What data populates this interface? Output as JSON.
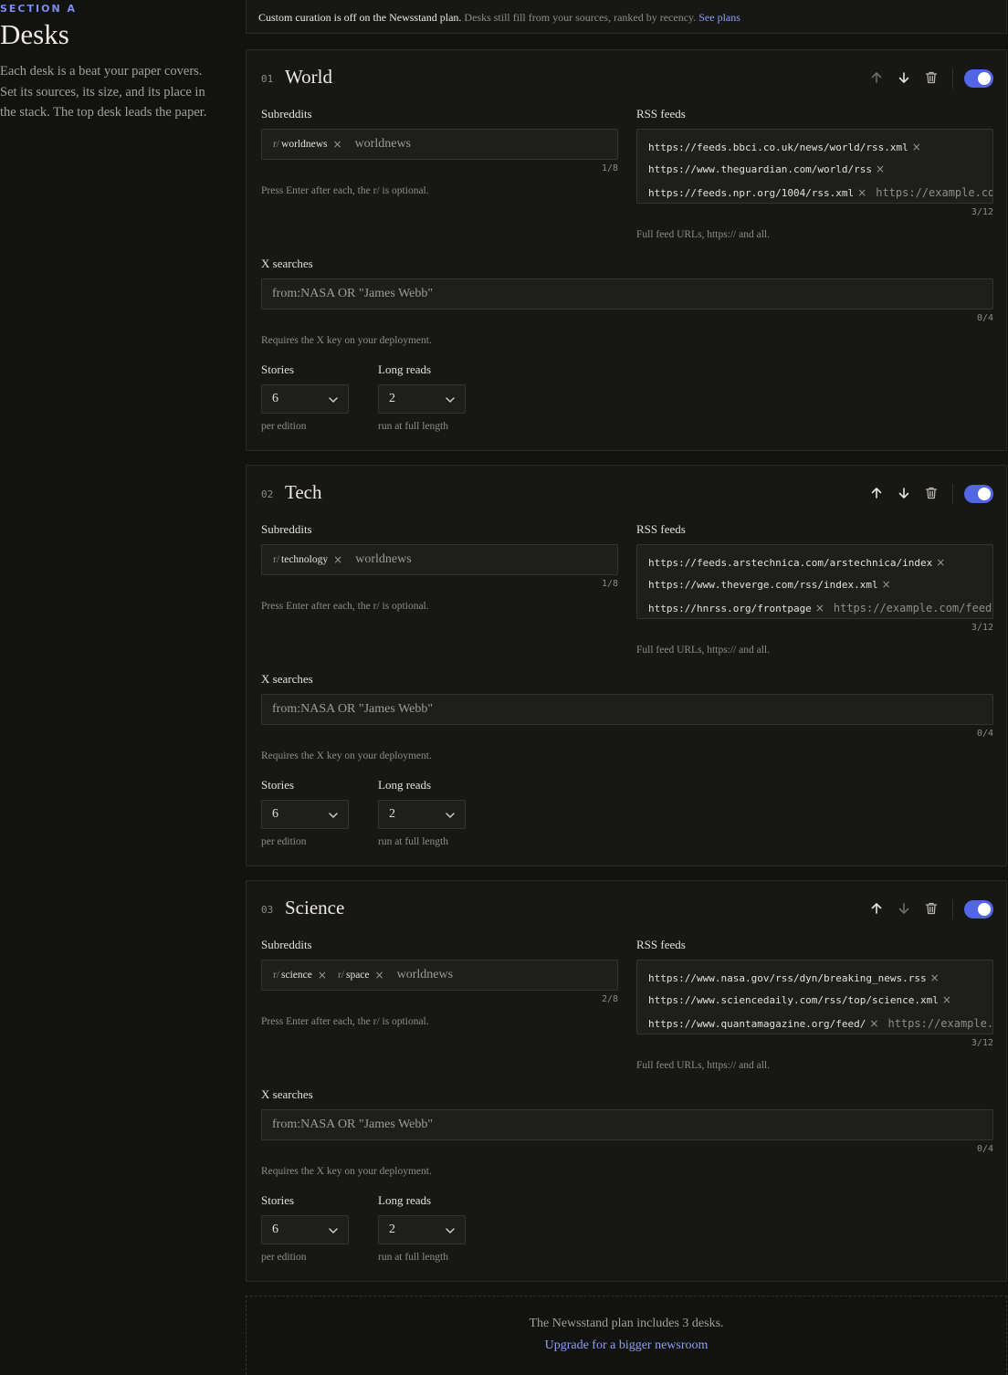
{
  "section": {
    "label": "SECTION A",
    "title": "Desks",
    "description": "Each desk is a beat your paper covers. Set its sources, its size, and its place in the stack. The top desk leads the paper."
  },
  "notice": {
    "strong": "Custom curation is off on the Newsstand plan.",
    "text": " Desks still fill from your sources, ranked by recency. ",
    "link": "See plans"
  },
  "labels": {
    "subreddits": "Subreddits",
    "rss_feeds": "RSS feeds",
    "x_searches": "X searches",
    "stories": "Stories",
    "long_reads": "Long reads",
    "subreddit_hint": "Press Enter after each, the r/ is optional.",
    "rss_hint": "Full feed URLs, https:// and all.",
    "x_hint": "Requires the X key on your deployment.",
    "stories_hint": "per edition",
    "long_reads_hint": "run at full length",
    "subreddit_prefix": "r/",
    "subreddit_placeholder": "worldnews",
    "feed_placeholder": "https://example.com/feed",
    "x_placeholder": "from:NASA OR \"James Webb\""
  },
  "desks": [
    {
      "num": "01",
      "name": "World",
      "subreddits": [
        "worldnews"
      ],
      "subreddit_count": "1/8",
      "feeds": [
        "https://feeds.bbci.co.uk/news/world/rss.xml",
        "https://www.theguardian.com/world/rss",
        "https://feeds.npr.org/1004/rss.xml"
      ],
      "feed_count": "3/12",
      "x_count": "0/4",
      "stories": "6",
      "long_reads": "2",
      "enabled": true
    },
    {
      "num": "02",
      "name": "Tech",
      "subreddits": [
        "technology"
      ],
      "subreddit_count": "1/8",
      "feeds": [
        "https://feeds.arstechnica.com/arstechnica/index",
        "https://www.theverge.com/rss/index.xml",
        "https://hnrss.org/frontpage"
      ],
      "feed_count": "3/12",
      "x_count": "0/4",
      "stories": "6",
      "long_reads": "2",
      "enabled": true
    },
    {
      "num": "03",
      "name": "Science",
      "subreddits": [
        "science",
        "space"
      ],
      "subreddit_count": "2/8",
      "feeds": [
        "https://www.nasa.gov/rss/dyn/breaking_news.rss",
        "https://www.sciencedaily.com/rss/top/science.xml",
        "https://www.quantamagazine.org/feed/"
      ],
      "feed_count": "3/12",
      "x_count": "0/4",
      "stories": "6",
      "long_reads": "2",
      "enabled": true
    }
  ],
  "upgrade": {
    "message": "The Newsstand plan includes 3 desks.",
    "link": "Upgrade for a bigger newsroom"
  },
  "colors": {
    "accent": "#5367e6",
    "link": "#8fa0f5",
    "background": "#121211",
    "card": "#171716"
  },
  "icons": [
    "arrow-up-icon",
    "arrow-down-icon",
    "trash-icon",
    "close-icon",
    "chevron-down-icon"
  ]
}
